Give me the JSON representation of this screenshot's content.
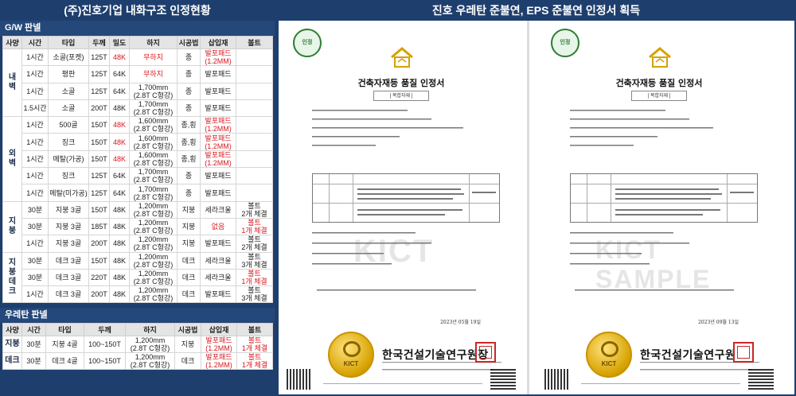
{
  "left_title": "(주)진호기업 내화구조 인정현황",
  "right_title": "진호 우레탄 준불연, EPS 준불연 인정서 획득",
  "gw": {
    "title": "G/W 판넬",
    "headers": [
      "사양",
      "시간",
      "타입",
      "두께",
      "밀도",
      "하지",
      "시공법",
      "삽입재",
      "볼트"
    ],
    "groups": [
      {
        "label": "내\n벽",
        "rows": [
          {
            "time": "1시간",
            "type": "소골(포켓)",
            "thick": "125T",
            "density": "48K",
            "density_red": true,
            "base": "무하지",
            "base_red": true,
            "method": "종",
            "insert": "발포패드\n(1.2MM)",
            "insert_red": true,
            "bolt": ""
          },
          {
            "time": "1시간",
            "type": "평판",
            "thick": "125T",
            "density": "64K",
            "density_red": false,
            "base": "무하지",
            "base_red": true,
            "method": "종",
            "insert": "발포패드",
            "insert_red": false,
            "bolt": ""
          },
          {
            "time": "1시간",
            "type": "소골",
            "thick": "125T",
            "density": "64K",
            "density_red": false,
            "base": "1,700mm\n(2.8T C형강)",
            "base_red": false,
            "method": "종",
            "insert": "발포패드",
            "insert_red": false,
            "bolt": ""
          },
          {
            "time": "1.5시간",
            "type": "소골",
            "thick": "200T",
            "density": "48K",
            "density_red": false,
            "base": "1,700mm\n(2.8T C형강)",
            "base_red": false,
            "method": "종",
            "insert": "발포패드",
            "insert_red": false,
            "bolt": ""
          }
        ]
      },
      {
        "label": "외\n벽",
        "rows": [
          {
            "time": "1시간",
            "type": "500골",
            "thick": "150T",
            "density": "48K",
            "density_red": true,
            "base": "1,600mm\n(2.8T C형강)",
            "base_red": false,
            "method": "종,횡",
            "insert": "발포패드\n(1.2MM)",
            "insert_red": true,
            "bolt": ""
          },
          {
            "time": "1시간",
            "type": "징크",
            "thick": "150T",
            "density": "48K",
            "density_red": true,
            "base": "1,600mm\n(2.8T C형강)",
            "base_red": false,
            "method": "종,횡",
            "insert": "발포패드\n(1.2MM)",
            "insert_red": true,
            "bolt": ""
          },
          {
            "time": "1시간",
            "type": "메탈(가공)",
            "thick": "150T",
            "density": "48K",
            "density_red": true,
            "base": "1,600mm\n(2.8T C형강)",
            "base_red": false,
            "method": "종,횡",
            "insert": "발포패드\n(1.2MM)",
            "insert_red": true,
            "bolt": ""
          },
          {
            "time": "1시간",
            "type": "징크",
            "thick": "125T",
            "density": "64K",
            "density_red": false,
            "base": "1,700mm\n(2.8T C형강)",
            "base_red": false,
            "method": "종",
            "insert": "발포패드",
            "insert_red": false,
            "bolt": ""
          },
          {
            "time": "1시간",
            "type": "메탈(미가공)",
            "thick": "125T",
            "density": "64K",
            "density_red": false,
            "base": "1,700mm\n(2.8T C형강)",
            "base_red": false,
            "method": "종",
            "insert": "발포패드",
            "insert_red": false,
            "bolt": ""
          }
        ]
      },
      {
        "label": "지\n붕",
        "rows": [
          {
            "time": "30분",
            "type": "지붕 3골",
            "thick": "150T",
            "density": "48K",
            "density_red": false,
            "base": "1,200mm\n(2.8T C형강)",
            "base_red": false,
            "method": "지붕",
            "insert": "세라크울",
            "insert_red": false,
            "bolt": "볼트\n2개 체결",
            "bolt_red": false
          },
          {
            "time": "30분",
            "type": "지붕 3골",
            "thick": "185T",
            "density": "48K",
            "density_red": false,
            "base": "1,200mm\n(2.8T C형강)",
            "base_red": false,
            "method": "지붕",
            "insert": "없음",
            "insert_red": true,
            "bolt": "볼트\n1개 체결",
            "bolt_red": true
          },
          {
            "time": "1시간",
            "type": "지붕 3골",
            "thick": "200T",
            "density": "48K",
            "density_red": false,
            "base": "1,200mm\n(2.8T C형강)",
            "base_red": false,
            "method": "지붕",
            "insert": "발포패드",
            "insert_red": false,
            "bolt": "볼트\n2개 체결",
            "bolt_red": false
          }
        ]
      },
      {
        "label": "지\n붕\n데\n크",
        "rows": [
          {
            "time": "30분",
            "type": "데크 3골",
            "thick": "150T",
            "density": "48K",
            "density_red": false,
            "base": "1,200mm\n(2.8T C형강)",
            "base_red": false,
            "method": "데크",
            "insert": "세라크울",
            "insert_red": false,
            "bolt": "볼트\n3개 체결",
            "bolt_red": false
          },
          {
            "time": "30분",
            "type": "데크 3골",
            "thick": "220T",
            "density": "48K",
            "density_red": false,
            "base": "1,200mm\n(2.8T C형강)",
            "base_red": false,
            "method": "데크",
            "insert": "세라크울",
            "insert_red": false,
            "bolt": "볼트\n1개 체결",
            "bolt_red": true
          },
          {
            "time": "1시간",
            "type": "데크 3골",
            "thick": "200T",
            "density": "48K",
            "density_red": false,
            "base": "1,200mm\n(2.8T C형강)",
            "base_red": false,
            "method": "데크",
            "insert": "발포패드",
            "insert_red": false,
            "bolt": "볼트\n3개 체결",
            "bolt_red": false
          }
        ]
      }
    ]
  },
  "urethane": {
    "title": "우레탄 판넬",
    "headers": [
      "사양",
      "시간",
      "타입",
      "두께",
      "하지",
      "시공법",
      "삽입재",
      "볼트"
    ],
    "rows": [
      {
        "spec": "지붕",
        "time": "30분",
        "type": "지붕 4골",
        "thick": "100~150T",
        "base": "1,200mm\n(2.8T C형강)",
        "method": "지붕",
        "insert": "발포패드\n(1.2MM)",
        "bolt": "볼트\n1개 체결"
      },
      {
        "spec": "데크",
        "time": "30분",
        "type": "데크 4골",
        "thick": "100~150T",
        "base": "1,200mm\n(2.8T C형강)",
        "method": "데크",
        "insert": "발포패드\n(1.2MM)",
        "bolt": "볼트\n1개 체결"
      }
    ]
  },
  "certs": [
    {
      "title": "건축자재등 품질 인정서",
      "subtitle": "[ 복합자재 ]",
      "date": "2023년 05월 19일",
      "watermark": "KICT",
      "org": "한국건설기술연구원장"
    },
    {
      "title": "건축자재등 품질 인정서",
      "subtitle": "[ 복합자재 ]",
      "date": "2023년 09월 13일",
      "watermark": "KICT SAMPLE",
      "org": "한국건설기술연구원"
    }
  ]
}
